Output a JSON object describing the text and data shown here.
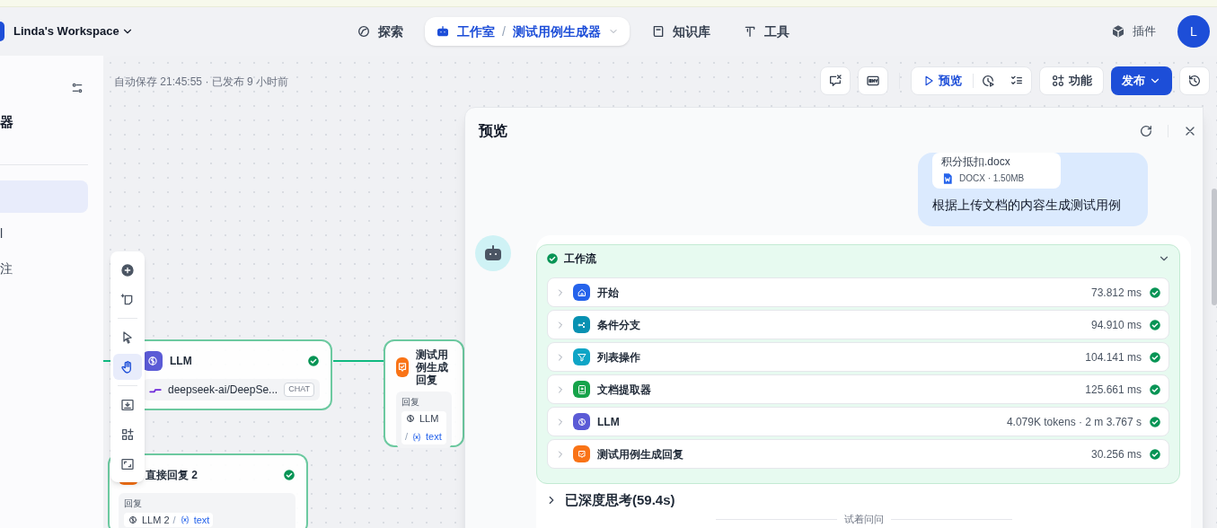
{
  "top_bar": {
    "workspace": "Linda's Workspace",
    "nav": [
      {
        "label": "探索",
        "selected": false
      },
      {
        "label": "工作室",
        "separator": "/",
        "sub": "测试用例生成器",
        "selected": true
      },
      {
        "label": "知识库",
        "selected": false
      },
      {
        "label": "工具",
        "selected": false
      }
    ],
    "plugins": "插件",
    "avatar": "L"
  },
  "sidebar": {
    "title": "器",
    "items": [
      {
        "selected": true
      },
      {
        "label": "l",
        "selected": false
      },
      {
        "label": "注",
        "selected": false
      }
    ]
  },
  "canvas": {
    "status": "自动保存 21:45:55 · 已发布 9 小时前",
    "actions": {
      "preview": "预览",
      "features": "功能",
      "publish": "发布"
    },
    "tools": [
      {
        "selected": false
      },
      {
        "selected": false
      },
      {
        "selected": false
      },
      {
        "selected": true
      },
      {
        "selected": false
      },
      {
        "selected": false
      },
      {
        "selected": false
      }
    ],
    "nodes": [
      {
        "kind": "llm",
        "title": "LLM",
        "model": "deepseek-ai/DeepSe...",
        "tag": "CHAT",
        "done": true
      },
      {
        "kind": "reply",
        "title": "测试用例生成回复",
        "field_label": "回复",
        "source": "LLM",
        "separator": "/",
        "variable": "text"
      },
      {
        "kind": "reply",
        "title": "直接回复 2",
        "field_label": "回复",
        "source": "LLM 2",
        "separator": "/",
        "variable": "text",
        "done": true
      }
    ]
  },
  "preview": {
    "title": "预览",
    "file": {
      "name": "积分抵扣.docx",
      "meta": "DOCX · 1.50MB"
    },
    "user_message": "根据上传文档的内容生成测试用例",
    "workflow": {
      "title": "工作流",
      "expanded": true,
      "steps": [
        {
          "kind": "start",
          "name": "开始",
          "time": "73.812 ms",
          "done": true
        },
        {
          "kind": "branch",
          "name": "条件分支",
          "time": "94.910 ms",
          "done": true
        },
        {
          "kind": "list",
          "name": "列表操作",
          "time": "104.141 ms",
          "done": true
        },
        {
          "kind": "extractor",
          "name": "文档提取器",
          "time": "125.661 ms",
          "done": true
        },
        {
          "kind": "llm",
          "name": "LLM",
          "time": "4.079K tokens · 2 m 3.767 s",
          "done": true
        },
        {
          "kind": "reply",
          "name": "测试用例生成回复",
          "time": "30.256 ms",
          "done": true
        }
      ]
    },
    "thinking": "已深度思考(59.4s)",
    "suggestions_label": "试着问问"
  }
}
